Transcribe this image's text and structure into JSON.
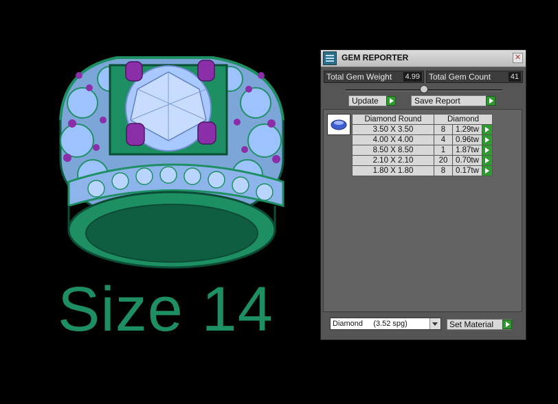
{
  "viewport": {
    "size_label": "Size 14",
    "colors": {
      "ring_metal": "#1e8f63",
      "gem": "#8fbfff",
      "prong": "#8a2fa8"
    }
  },
  "panel": {
    "title": "GEM REPORTER",
    "close_icon": "close-icon",
    "total_weight_label": "Total Gem Weight",
    "total_weight_value": "4.99",
    "total_count_label": "Total Gem Count",
    "total_count_value": "41",
    "update_label": "Update",
    "save_report_label": "Save Report",
    "table": {
      "header_left": "Diamond Round",
      "header_right": "Diamond",
      "rows": [
        {
          "size": "3.50 X 3.50",
          "count": "8",
          "weight": "1.29tw"
        },
        {
          "size": "4.00 X 4.00",
          "count": "4",
          "weight": "0.96tw"
        },
        {
          "size": "8.50 X 8.50",
          "count": "1",
          "weight": "1.87tw"
        },
        {
          "size": "2.10 X 2.10",
          "count": "20",
          "weight": "0.70tw"
        },
        {
          "size": "1.80 X 1.80",
          "count": "8",
          "weight": "0.17tw"
        }
      ]
    },
    "material_select": "Diamond     (3.52 spg)",
    "set_material_label": "Set Material",
    "accent_color": "#2f9a2f"
  }
}
